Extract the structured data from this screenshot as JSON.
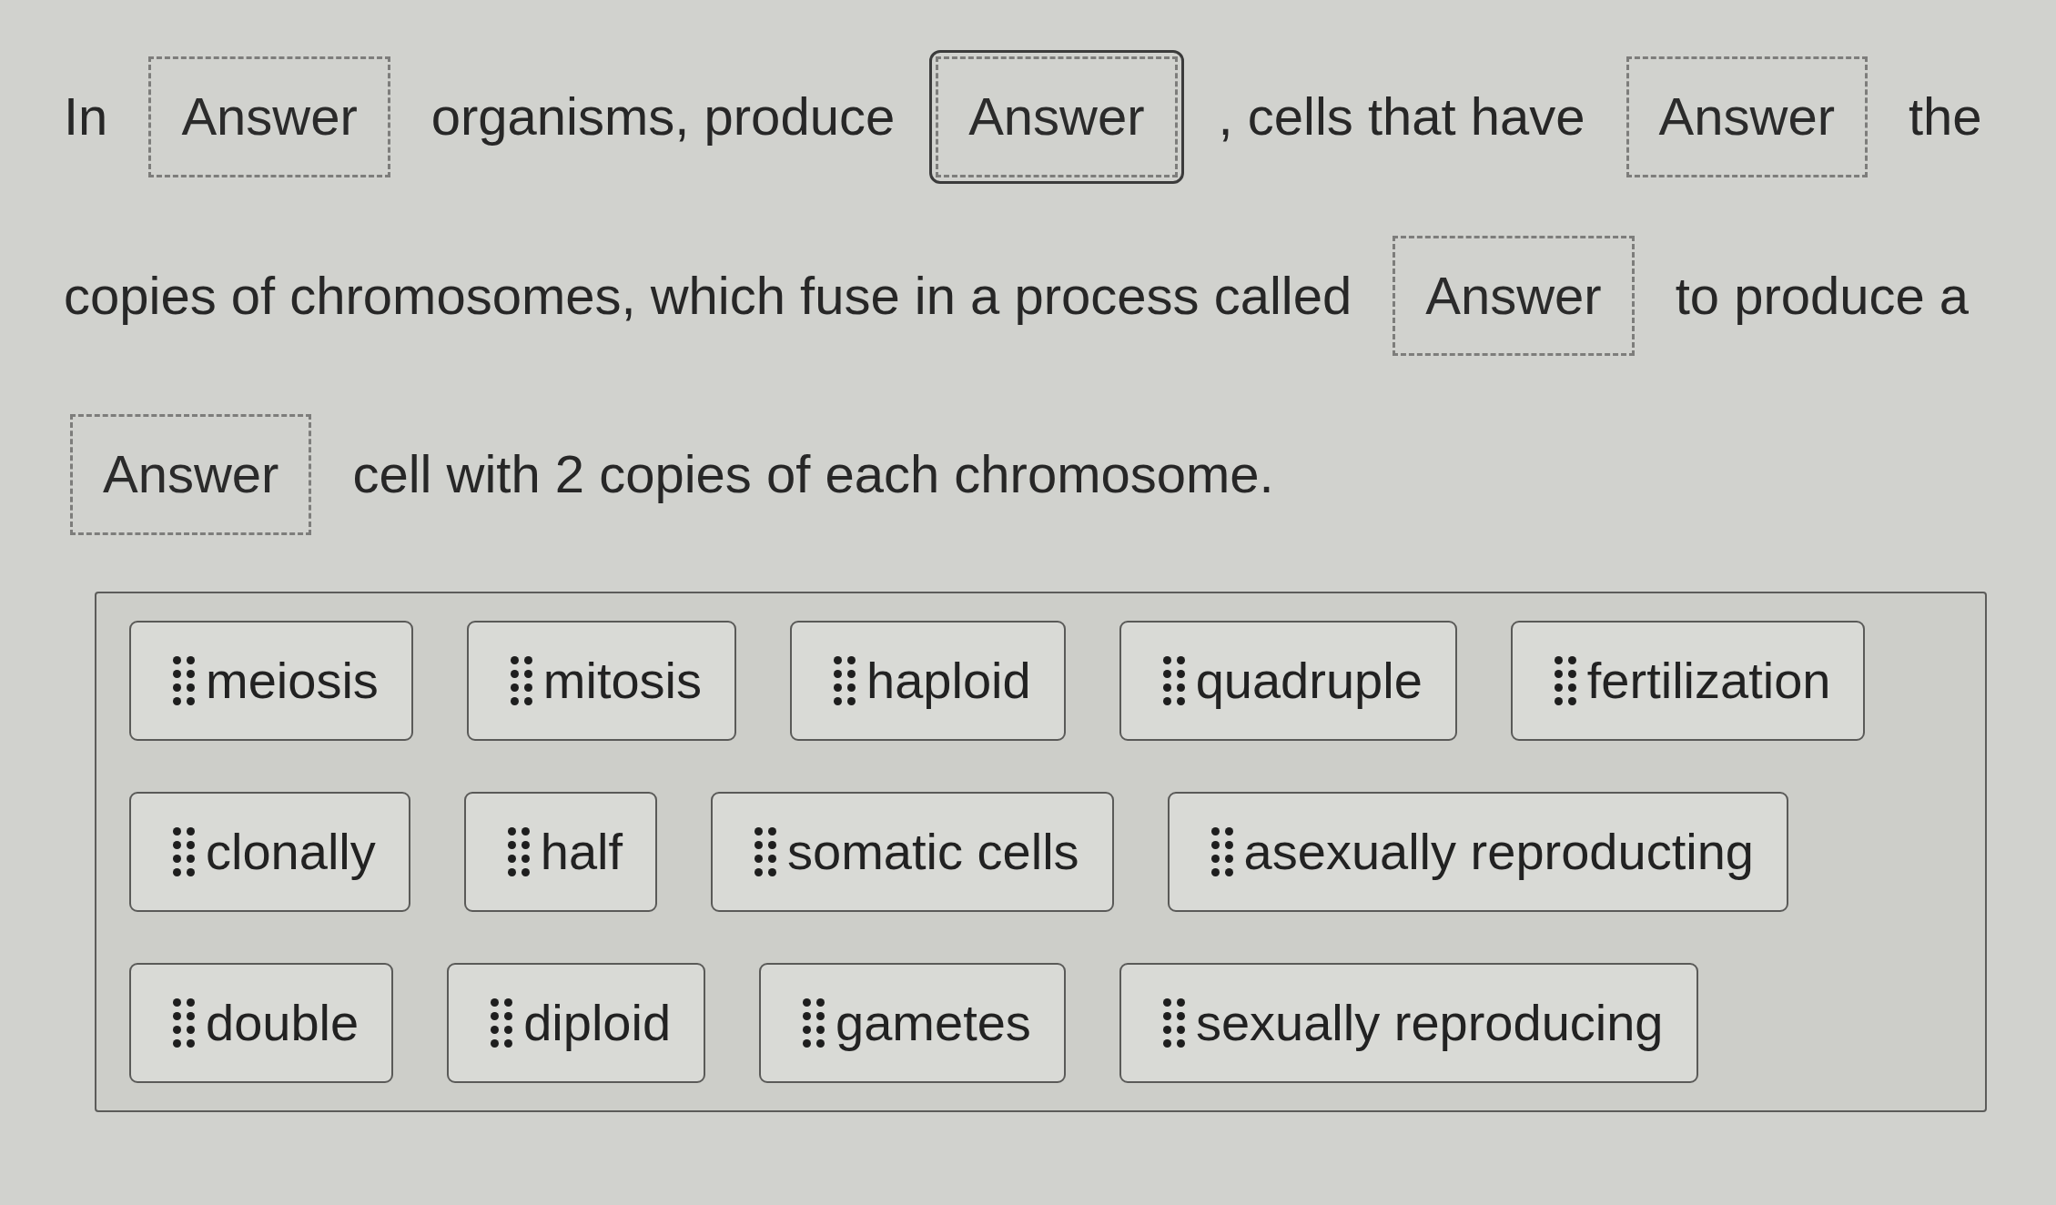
{
  "question": {
    "parts": [
      {
        "kind": "text",
        "text": "In"
      },
      {
        "kind": "blank",
        "placeholder": "Answer",
        "selected": false
      },
      {
        "kind": "text",
        "text": "organisms, produce"
      },
      {
        "kind": "blank",
        "placeholder": "Answer",
        "selected": true
      },
      {
        "kind": "text",
        "text": ", cells that have"
      },
      {
        "kind": "blank",
        "placeholder": "Answer",
        "selected": false
      },
      {
        "kind": "text",
        "text": "the"
      },
      {
        "kind": "text",
        "text": "copies of chromosomes, which fuse in a process called"
      },
      {
        "kind": "blank",
        "placeholder": "Answer",
        "selected": false
      },
      {
        "kind": "text",
        "text": "to produce a"
      },
      {
        "kind": "blank",
        "placeholder": "Answer",
        "selected": false
      },
      {
        "kind": "text",
        "text": "cell with 2 copies of each chromosome."
      }
    ]
  },
  "word_bank": {
    "options": [
      {
        "label": "meiosis"
      },
      {
        "label": "mitosis"
      },
      {
        "label": "haploid"
      },
      {
        "label": "quadruple"
      },
      {
        "label": "fertilization"
      },
      {
        "label": "clonally"
      },
      {
        "label": "half"
      },
      {
        "label": "somatic cells"
      },
      {
        "label": "asexually reproducting"
      },
      {
        "label": "double"
      },
      {
        "label": "diploid"
      },
      {
        "label": "gametes"
      },
      {
        "label": "sexually reproducing"
      }
    ]
  }
}
